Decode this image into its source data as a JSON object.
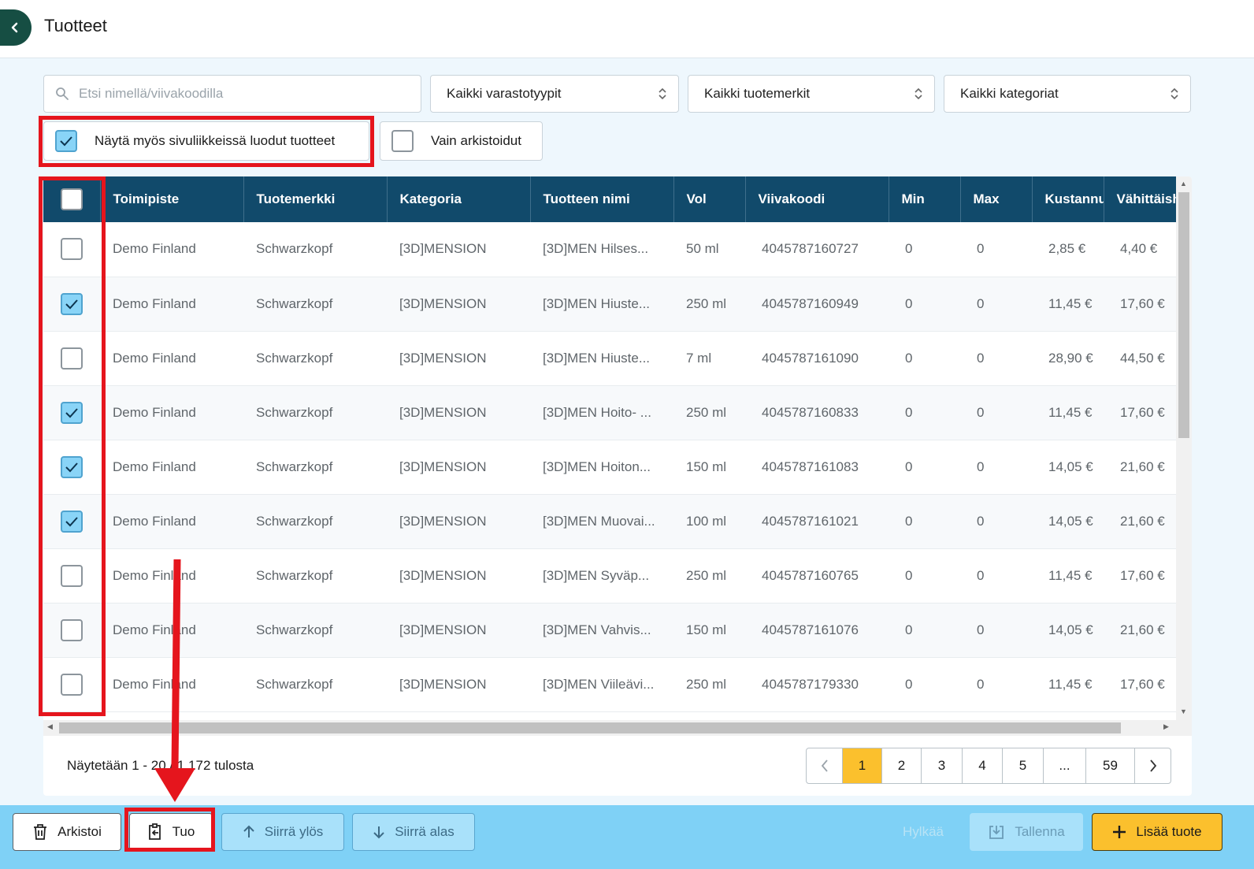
{
  "header": {
    "title": "Tuotteet"
  },
  "filters": {
    "search_placeholder": "Etsi nimellä/viivakoodilla",
    "storage_type": "Kaikki varastotyypit",
    "brand": "Kaikki tuotemerkit",
    "category": "Kaikki kategoriat",
    "show_sidebusiness_label": "Näytä myös sivuliikkeissä luodut tuotteet",
    "show_sidebusiness_checked": true,
    "archived_only_label": "Vain arkistoidut",
    "archived_only_checked": false
  },
  "table": {
    "columns": [
      "Toimipiste",
      "Tuotemerkki",
      "Kategoria",
      "Tuotteen nimi",
      "Vol",
      "Viivakoodi",
      "Min",
      "Max",
      "Kustannus",
      "Vähittäishinta"
    ],
    "rows": [
      {
        "checked": false,
        "location": "Demo Finland",
        "brand": "Schwarzkopf",
        "category": "[3D]MENSION",
        "name": "[3D]MEN Hilses...",
        "vol": "50 ml",
        "barcode": "4045787160727",
        "min": "0",
        "max": "0",
        "cost": "2,85 €",
        "retail": "4,40 €"
      },
      {
        "checked": true,
        "location": "Demo Finland",
        "brand": "Schwarzkopf",
        "category": "[3D]MENSION",
        "name": "[3D]MEN Hiuste...",
        "vol": "250 ml",
        "barcode": "4045787160949",
        "min": "0",
        "max": "0",
        "cost": "11,45 €",
        "retail": "17,60 €"
      },
      {
        "checked": false,
        "location": "Demo Finland",
        "brand": "Schwarzkopf",
        "category": "[3D]MENSION",
        "name": "[3D]MEN Hiuste...",
        "vol": "7 ml",
        "barcode": "4045787161090",
        "min": "0",
        "max": "0",
        "cost": "28,90 €",
        "retail": "44,50 €"
      },
      {
        "checked": true,
        "location": "Demo Finland",
        "brand": "Schwarzkopf",
        "category": "[3D]MENSION",
        "name": "[3D]MEN Hoito- ...",
        "vol": "250 ml",
        "barcode": "4045787160833",
        "min": "0",
        "max": "0",
        "cost": "11,45 €",
        "retail": "17,60 €"
      },
      {
        "checked": true,
        "location": "Demo Finland",
        "brand": "Schwarzkopf",
        "category": "[3D]MENSION",
        "name": "[3D]MEN Hoiton...",
        "vol": "150 ml",
        "barcode": "4045787161083",
        "min": "0",
        "max": "0",
        "cost": "14,05 €",
        "retail": "21,60 €"
      },
      {
        "checked": true,
        "location": "Demo Finland",
        "brand": "Schwarzkopf",
        "category": "[3D]MENSION",
        "name": "[3D]MEN Muovai...",
        "vol": "100 ml",
        "barcode": "4045787161021",
        "min": "0",
        "max": "0",
        "cost": "14,05 €",
        "retail": "21,60 €"
      },
      {
        "checked": false,
        "location": "Demo Finland",
        "brand": "Schwarzkopf",
        "category": "[3D]MENSION",
        "name": "[3D]MEN Syväp...",
        "vol": "250 ml",
        "barcode": "4045787160765",
        "min": "0",
        "max": "0",
        "cost": "11,45 €",
        "retail": "17,60 €"
      },
      {
        "checked": false,
        "location": "Demo Finland",
        "brand": "Schwarzkopf",
        "category": "[3D]MENSION",
        "name": "[3D]MEN Vahvis...",
        "vol": "150 ml",
        "barcode": "4045787161076",
        "min": "0",
        "max": "0",
        "cost": "14,05 €",
        "retail": "21,60 €"
      },
      {
        "checked": false,
        "location": "Demo Finland",
        "brand": "Schwarzkopf",
        "category": "[3D]MENSION",
        "name": "[3D]MEN Viileävi...",
        "vol": "250 ml",
        "barcode": "4045787179330",
        "min": "0",
        "max": "0",
        "cost": "11,45 €",
        "retail": "17,60 €"
      }
    ]
  },
  "pagination": {
    "summary": "Näytetään 1 - 20 / 1 172 tulosta",
    "pages": [
      "1",
      "2",
      "3",
      "4",
      "5",
      "...",
      "59"
    ],
    "current": "1"
  },
  "footer": {
    "archive": "Arkistoi",
    "import": "Tuo",
    "move_up": "Siirrä ylös",
    "move_down": "Siirrä alas",
    "reject": "Hylkää",
    "save": "Tallenna",
    "add_product": "Lisää tuote"
  },
  "colors": {
    "header_bg": "#114a6b",
    "accent": "#fbc02d",
    "footer_bg": "#7fd1f6",
    "highlight": "#e5151d",
    "back_button": "#164e43"
  }
}
